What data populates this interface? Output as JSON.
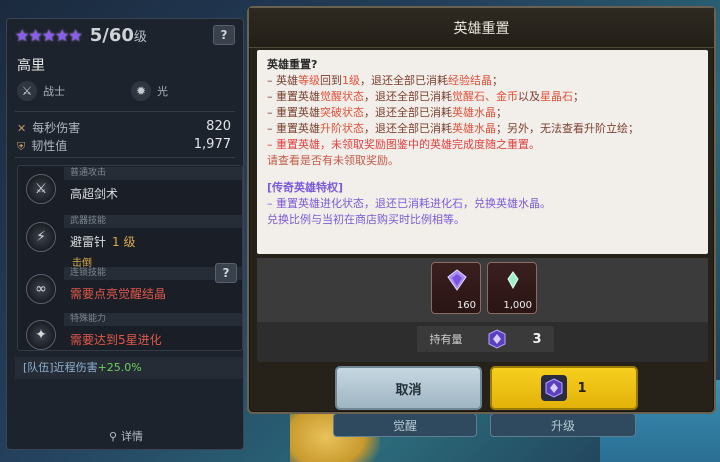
{
  "background": {
    "tab_left": "觉醒",
    "tab_right": "升级"
  },
  "character": {
    "stars": "★★★★★",
    "level_current": "5/60",
    "level_unit": "级",
    "help": "?",
    "name": "高里",
    "class": "战士",
    "element": "光",
    "stats": [
      {
        "label": "每秒伤害",
        "value": "820"
      },
      {
        "label": "韧性值",
        "value": "1,977"
      }
    ],
    "skills": [
      {
        "category": "普通攻击",
        "name": "高超剑术"
      },
      {
        "category": "武器技能",
        "name": "避雷针",
        "level": "1 级",
        "sub": "击倒"
      },
      {
        "category": "连锁技能",
        "name": "需要点亮觉醒结晶"
      },
      {
        "category": "特殊能力",
        "name": "需要达到5星进化"
      }
    ],
    "team_bonus_label": "[队伍]近程伤害",
    "team_bonus_value": "+25.0%",
    "detail_label": "详情"
  },
  "modal": {
    "title": "英雄重置",
    "question": "英雄重置?",
    "lines": [
      {
        "pre": "– 英雄",
        "a": "等级",
        "mid": "回到",
        "b": "1级",
        "post": "，退还全部已消耗",
        "c": "经验结晶",
        "end": "；"
      },
      {
        "pre": "– 重置英雄",
        "a": "觉醒状态",
        "mid": "，退还全部已消耗",
        "b": "觉醒石、金币",
        "post": "以及",
        "c": "星晶石",
        "end": "；"
      },
      {
        "pre": "– 重置英雄",
        "a": "突破状态",
        "mid": "，退还全部已消耗",
        "b": "英雄水晶",
        "post": "",
        "c": "",
        "end": "；"
      },
      {
        "pre": "– 重置英雄",
        "a": "升阶状态",
        "mid": "，退还全部已消耗",
        "b": "英雄水晶",
        "post": "；另外，无法查看升阶立绘",
        "c": "",
        "end": "；"
      }
    ],
    "warning": "– 重置英雄，未领取奖励图鉴中的英雄完成度随之重置。",
    "question_unclaimed": "请查看是否有未领取奖励。",
    "privilege_title": "[传奇英雄特权]",
    "privilege_lines": [
      "– 重置英雄进化状态，退还已消耗进化石，兑换英雄水晶。",
      "兑换比例与当初在商店购买时比例相等。"
    ],
    "rewards": [
      {
        "icon": "purple-crystal-icon",
        "count": "160"
      },
      {
        "icon": "green-crystal-icon",
        "count": "1,000"
      }
    ],
    "owned_label": "持有量",
    "owned_value": "3",
    "cancel_label": "取消",
    "confirm_cost": "1",
    "colors": {
      "confirm": "#f6cf1e",
      "cancel": "#c6d8e2",
      "privilege": "#7b5bd6",
      "warning": "#e04040"
    }
  }
}
